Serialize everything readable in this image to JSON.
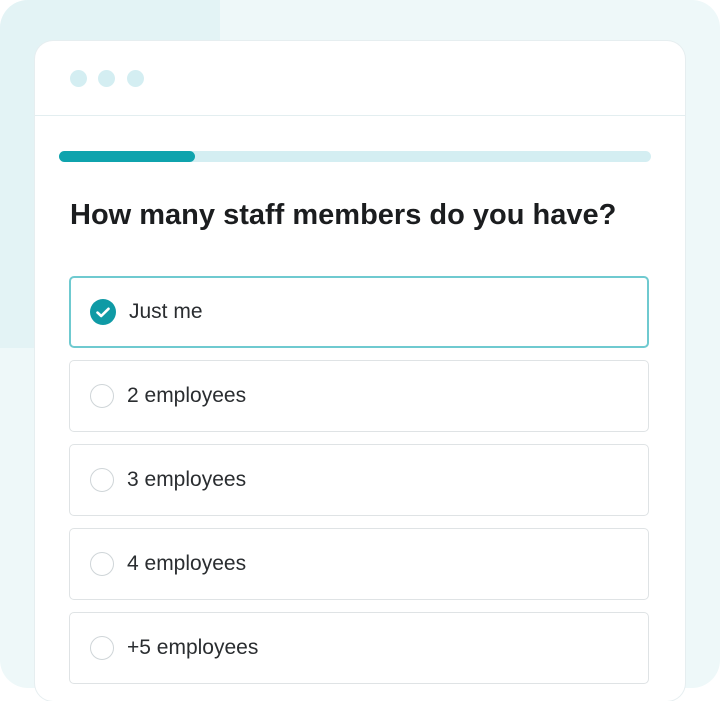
{
  "survey": {
    "progress_fraction": 0.23,
    "question": "How many staff members do you have?",
    "options": [
      {
        "label": "Just me",
        "selected": true
      },
      {
        "label": "2 employees",
        "selected": false
      },
      {
        "label": "3 employees",
        "selected": false
      },
      {
        "label": "4 employees",
        "selected": false
      },
      {
        "label": "+5 employees",
        "selected": false
      }
    ]
  },
  "colors": {
    "accent": "#0fa3ad",
    "selected_border": "#6fcad0",
    "track": "#d4eef2"
  },
  "icons": {
    "selected": "check-circle-icon",
    "unselected": "radio-empty-icon"
  }
}
